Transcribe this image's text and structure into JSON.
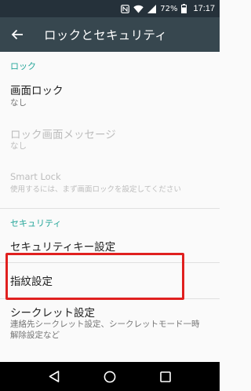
{
  "status_bar": {
    "battery_percent": "72%",
    "time": "17:17",
    "icons": [
      "nfc-icon",
      "wifi-icon",
      "signal-icon",
      "battery-icon"
    ]
  },
  "app_bar": {
    "title": "ロックとセキュリティ",
    "back_icon": "arrow-back-icon"
  },
  "sections": {
    "lock": {
      "header": "ロック",
      "items": [
        {
          "title": "画面ロック",
          "summary": "なし",
          "enabled": true
        },
        {
          "title": "ロック画面メッセージ",
          "summary": "なし",
          "enabled": false
        },
        {
          "title": "Smart Lock",
          "summary": "使用するには、まず画面ロックを設定してください",
          "enabled": false
        }
      ]
    },
    "security": {
      "header": "セキュリティ",
      "items": [
        {
          "title": "セキュリティキー設定"
        },
        {
          "title": "指紋設定"
        },
        {
          "title": "シークレット設定",
          "summary_line1": "連絡先シークレット設定、シークレットモード一時",
          "summary_line2": "解除設定など"
        }
      ]
    }
  },
  "colors": {
    "status_bar": "#25313a",
    "app_bar": "#37474f",
    "accent": "#26a69a",
    "highlight": "#e0201f",
    "nav_bar": "#000000"
  },
  "nav_bar": {
    "buttons": [
      "back-triangle-icon",
      "home-circle-icon",
      "recents-square-icon"
    ]
  }
}
